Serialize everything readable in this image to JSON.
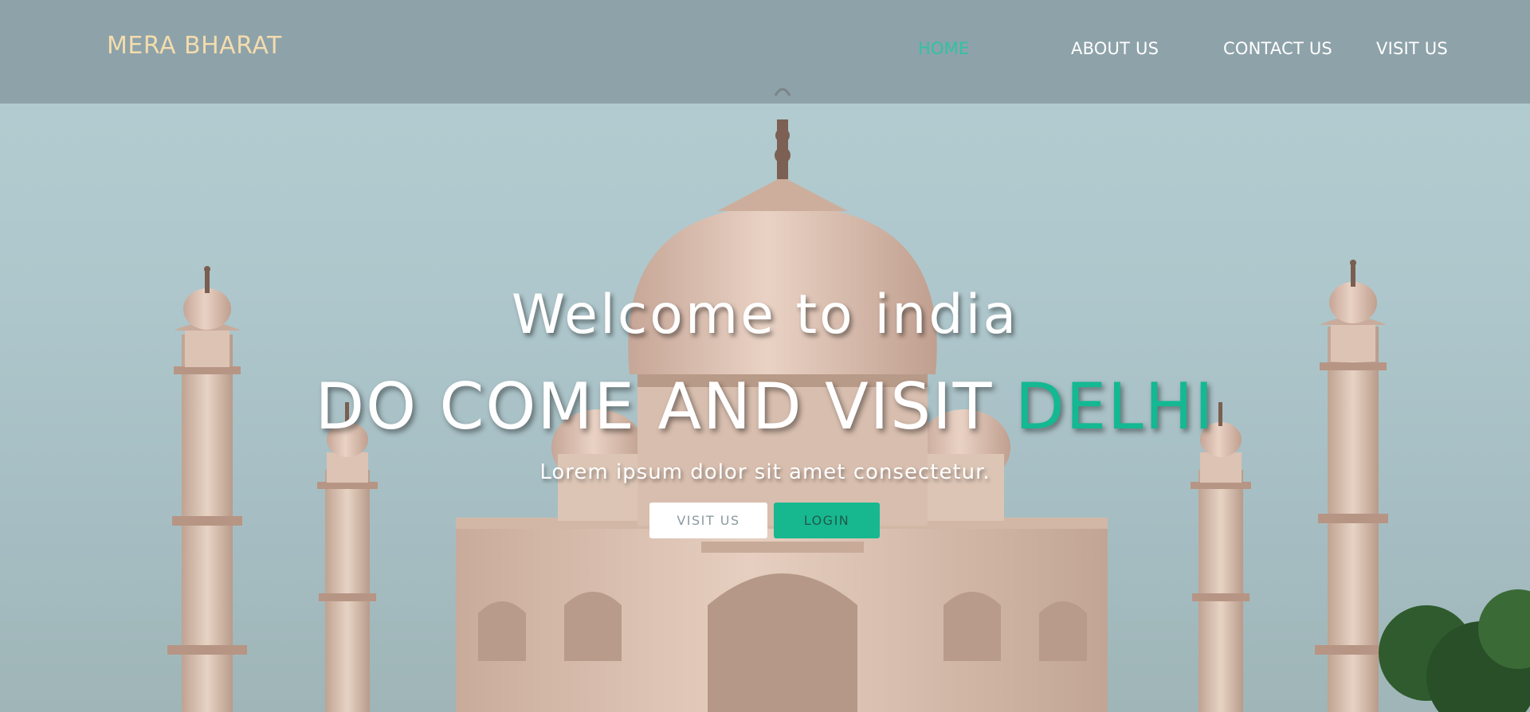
{
  "header": {
    "brand": "MERA BHARAT",
    "nav": [
      {
        "label": "HOME",
        "active": true
      },
      {
        "label": "ABOUT US",
        "active": false
      },
      {
        "label": "CONTACT US",
        "active": false
      },
      {
        "label": "VISIT US",
        "active": false
      }
    ]
  },
  "hero": {
    "welcome": "Welcome to india",
    "headline_main": "DO COME AND VISIT ",
    "headline_accent": "DELHI",
    "tagline": "Lorem ipsum dolor sit amet consectetur.",
    "visit_button": "VISIT US",
    "login_button": "LOGIN",
    "background_image": "taj-mahal-photo"
  },
  "colors": {
    "accent": "#14b892",
    "brand": "#f3dcad",
    "nav_active": "#2fc3a2"
  }
}
